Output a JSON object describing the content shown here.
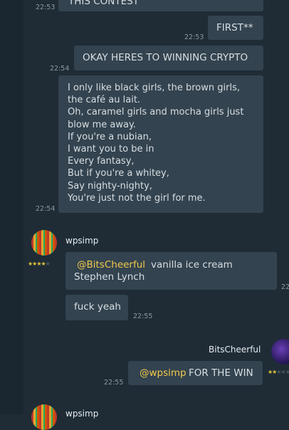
{
  "messages": [
    {
      "id": "m0",
      "text": "THIS CONTEST",
      "time": "22:53"
    },
    {
      "id": "m1",
      "text": "FIRST**",
      "time": "22:53"
    },
    {
      "id": "m2",
      "text": "OKAY HERES TO WINNING CRYPTO",
      "time": "22:54"
    },
    {
      "id": "m3",
      "lines": [
        "I only like black girls, the brown girls,",
        "the café au lait.",
        "Oh, caramel girls and mocha girls just",
        "blow me away.",
        "If you're a nubian,",
        "I want you to be in",
        "Every fantasy,",
        "But if you're a whitey,",
        "Say nighty-nighty,",
        "You're just not the girl for me."
      ],
      "time": "22:54"
    }
  ],
  "wpsimp": {
    "name": "wpsimp",
    "stars": {
      "filled": 4,
      "total": 5
    },
    "msg1": {
      "mention": "@BitsCheerful",
      "text": "vanilla ice cream",
      "line2": "Stephen Lynch",
      "time": "22"
    },
    "msg2": {
      "text": "fuck yeah",
      "time": "22:55"
    }
  },
  "bits": {
    "name": "BitsCheerful",
    "stars": {
      "filled": 2,
      "total": 5
    },
    "msg": {
      "mention": "@wpsimp",
      "text": "FOR THE WIN",
      "time": "22:55"
    }
  },
  "next": {
    "name": "wpsimp"
  }
}
